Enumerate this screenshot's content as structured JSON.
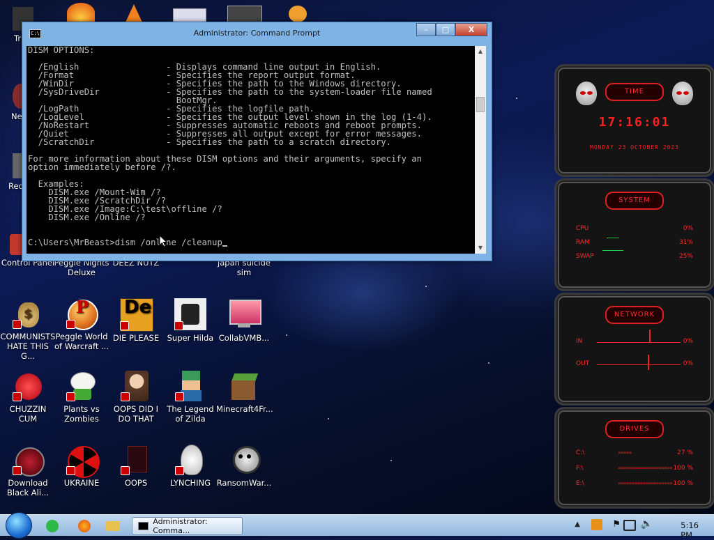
{
  "window": {
    "title": "Administrator: Command Prompt",
    "app_icon_text": "C:\\",
    "minimize": "–",
    "maximize": "□",
    "close": "X"
  },
  "console": {
    "lines": [
      "DISM OPTIONS:",
      "",
      "  /English                 - Displays command line output in English.",
      "  /Format                  - Specifies the report output format.",
      "  /WinDir                  - Specifies the path to the Windows directory.",
      "  /SysDriveDir             - Specifies the path to the system-loader file named",
      "                             BootMgr.",
      "  /LogPath                 - Specifies the logfile path.",
      "  /LogLevel                - Specifies the output level shown in the log (1-4).",
      "  /NoRestart               - Suppresses automatic reboots and reboot prompts.",
      "  /Quiet                   - Suppresses all output except for error messages.",
      "  /ScratchDir              - Specifies the path to a scratch directory.",
      "",
      "For more information about these DISM options and their arguments, specify an",
      "option immediately before /?.",
      "",
      "  Examples:",
      "    DISM.exe /Mount-Wim /?",
      "    DISM.exe /ScratchDir /?",
      "    DISM.exe /Image:C:\\test\\offline /?",
      "    DISM.exe /Online /?",
      "",
      "",
      ""
    ],
    "prompt": "C:\\Users\\MrBeast>dism /online /cleanup"
  },
  "desktop_icons": [
    {
      "label": "Control Panel",
      "icon": "control-panel-icon",
      "color": "#c0392b"
    },
    {
      "label": "Peggle Nights Deluxe",
      "icon": "peggle-nights-icon",
      "color": "#6b4"
    },
    {
      "label": "DEEZ NUTZ",
      "icon": "deez-nutz-icon",
      "color": "#777"
    },
    {
      "label": "japan suicide sim",
      "icon": "japan-sim-icon",
      "color": "#555"
    },
    {
      "label": "COMMUNISTS HATE THIS G...",
      "icon": "money-bag-icon",
      "color": "#c9a14a"
    },
    {
      "label": "Peggle World of Warcraft ...",
      "icon": "peggle-wow-icon",
      "color": "#e07020"
    },
    {
      "label": "DIE PLEASE",
      "icon": "die-please-icon",
      "color": "#e8a020"
    },
    {
      "label": "Super Hilda",
      "icon": "super-hilda-icon",
      "color": "#eee"
    },
    {
      "label": "CollabVMB...",
      "icon": "collabvm-icon",
      "color": "#c48"
    },
    {
      "label": "CHUZZIN CUM",
      "icon": "chuzzle-icon",
      "color": "#e22"
    },
    {
      "label": "Plants vs Zombies",
      "icon": "plants-vs-zombies-icon",
      "color": "#ddd"
    },
    {
      "label": "OOPS DID I DO THAT",
      "icon": "portrait-icon",
      "color": "#a87"
    },
    {
      "label": "The Legend of Zilda",
      "icon": "zelda-icon",
      "color": "#3a8"
    },
    {
      "label": "Minecraft4Fr...",
      "icon": "minecraft-icon",
      "color": "#5a3"
    },
    {
      "label": "Download Black Ali...",
      "icon": "alienware-icon",
      "color": "#900"
    },
    {
      "label": "UKRAINE",
      "icon": "radiation-icon",
      "color": "#d11"
    },
    {
      "label": "OOPS",
      "icon": "oops-icon",
      "color": "#511"
    },
    {
      "label": "LYNCHING",
      "icon": "lynching-icon",
      "color": "#eee"
    },
    {
      "label": "RansomWar...",
      "icon": "skull-icon",
      "color": "#ccc"
    }
  ],
  "partial_icons": [
    {
      "label": "Tr",
      "icon": "partial-icon"
    },
    {
      "label": "Ne",
      "icon": "partial-icon"
    },
    {
      "label": "Rec",
      "icon": "recycle-bin-icon"
    }
  ],
  "widgets": {
    "time": {
      "header": "TIME",
      "clock": "17:16:01",
      "date": "MONDAY 23 OCTOBER 2023"
    },
    "system": {
      "header": "SYSTEM",
      "rows": [
        {
          "label": "CPU",
          "value": "0%"
        },
        {
          "label": "RAM",
          "value": "31%"
        },
        {
          "label": "SWAP",
          "value": "25%"
        }
      ]
    },
    "network": {
      "header": "NETWORK",
      "rows": [
        {
          "label": "IN",
          "value": "0%"
        },
        {
          "label": "OUT",
          "value": "0%"
        }
      ]
    },
    "drives": {
      "header": "DRIVES",
      "rows": [
        {
          "label": "C:\\",
          "value": "27 %",
          "fill": 0.27
        },
        {
          "label": "F:\\",
          "value": "100 %",
          "fill": 1.0
        },
        {
          "label": "E:\\",
          "value": "100 %",
          "fill": 1.0
        }
      ]
    }
  },
  "taskbar": {
    "task_label": "Administrator: Comma...",
    "clock": "5:16 PM"
  }
}
